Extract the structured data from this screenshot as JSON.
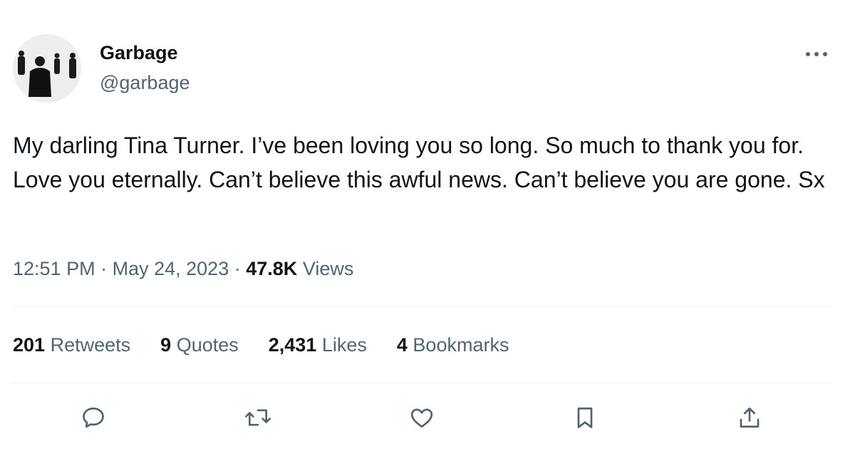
{
  "author": {
    "display_name": "Garbage",
    "handle": "@garbage",
    "avatar_icon": "band-photo-avatar"
  },
  "more_icon": "more-dots-icon",
  "tweet": {
    "text": "My darling Tina Turner. I’ve been loving you so long. So much to thank you for. Love you eternally. Can’t believe this awful news. Can’t believe you are gone. Sx",
    "time": "12:51 PM",
    "date": "May 24, 2023",
    "separator": "·",
    "views_count": "47.8K",
    "views_label": "Views"
  },
  "stats": {
    "retweets": {
      "count": "201",
      "label": "Retweets"
    },
    "quotes": {
      "count": "9",
      "label": "Quotes"
    },
    "likes": {
      "count": "2,431",
      "label": "Likes"
    },
    "bookmarks": {
      "count": "4",
      "label": "Bookmarks"
    }
  },
  "actions": [
    "reply-icon",
    "retweet-icon",
    "like-icon",
    "bookmark-icon",
    "share-icon"
  ],
  "colors": {
    "text_primary": "#0f1419",
    "text_secondary": "#536471",
    "divider": "#eff3f4",
    "icon": "#536471"
  }
}
